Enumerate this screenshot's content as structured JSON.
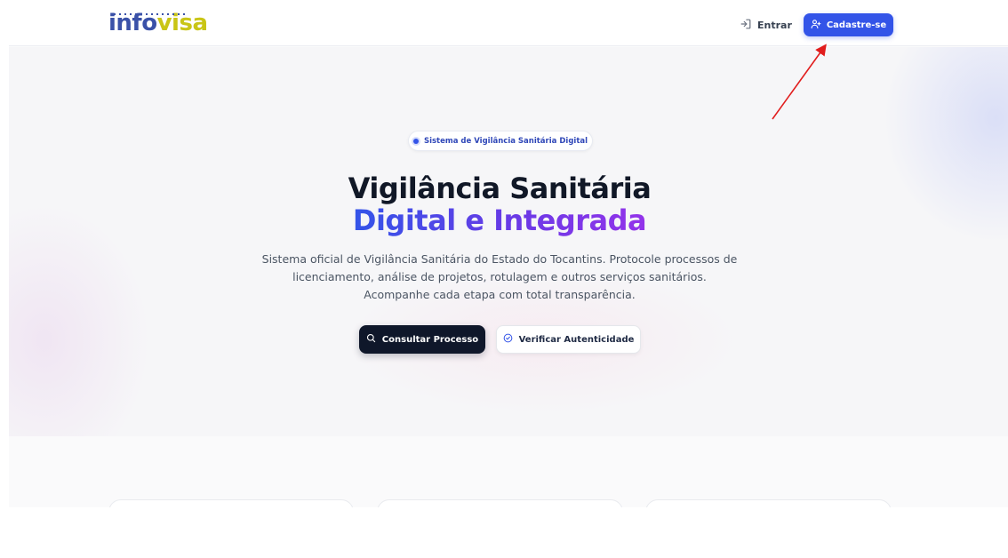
{
  "header": {
    "logo_part1": "info",
    "logo_part2": "visa",
    "login_label": "Entrar",
    "signup_label": "Cadastre-se"
  },
  "hero": {
    "badge": "Sistema de Vigilância Sanitária Digital",
    "title_line1": "Vigilância Sanitária",
    "title_line2": "Digital e Integrada",
    "description": "Sistema oficial de Vigilância Sanitária do Estado do Tocantins. Protocole processos de licenciamento, análise de projetos, rotulagem e outros serviços sanitários. Acompanhe cada etapa com total transparência.",
    "primary_button": "Consultar Processo",
    "secondary_button": "Verificar Autenticidade"
  },
  "icons": {
    "login": "login-icon",
    "signup": "user-plus-icon",
    "search": "search-icon",
    "verify": "check-circle-icon"
  },
  "colors": {
    "primary_blue": "#3354e8",
    "dark_button": "#0f172a",
    "logo_blue": "#3a51a8",
    "logo_yellow": "#c9c515",
    "gradient_purple": "#9333ea",
    "annotation_red": "#e11d1d"
  }
}
